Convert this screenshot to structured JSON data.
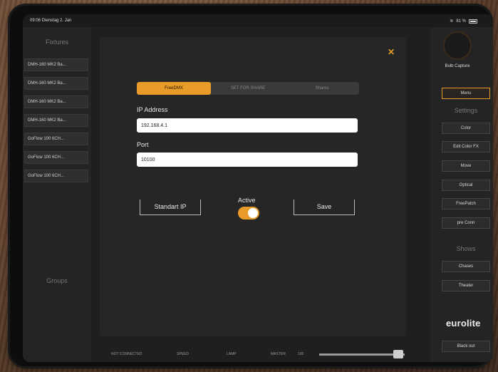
{
  "statusbar": {
    "time_date": "09:06 Dienstag 2. Jan",
    "battery": "81 %"
  },
  "left_sidebar": {
    "fixtures_heading": "Fixtures",
    "fixtures": [
      "DMH-160 MK2 Ba...",
      "DMH-160 MK2 Ba...",
      "DMH-160 MK2 Ba...",
      "DMH-160 MK2 Ba...",
      "GoFlow 100 6CH...",
      "GoFlow 100 6CH...",
      "GoFlow 100 6CH..."
    ],
    "groups_heading": "Groups"
  },
  "modal": {
    "close_label": "✕",
    "segments": [
      "FreeDMX",
      "SET FOR SHARE",
      "Shares"
    ],
    "active_segment": 0,
    "ip_label": "IP Address",
    "ip_value": "192.168.4.1",
    "port_label": "Port",
    "port_value": "10100",
    "standart_ip_label": "Standart IP",
    "active_label": "Active",
    "active_on": true,
    "save_label": "Save"
  },
  "bottom_bar": {
    "status": "NOT CONNECTED",
    "item2": "SPEED",
    "item3": "LAMP",
    "item4": "MASTER",
    "item5": "100",
    "master_level": 0.95
  },
  "right_sidebar": {
    "logo_text": "Bulb Capture",
    "menu_label": "Menu",
    "settings_heading": "Settings",
    "buttons": [
      "Color",
      "Edit Color FX",
      "Move",
      "Optical",
      "FreePatch",
      "pre Conn"
    ],
    "shows_heading": "Shows",
    "show_buttons": [
      "Chases",
      "Theater"
    ],
    "brand": "eurolite",
    "blackout_label": "Black out"
  },
  "colors": {
    "accent": "#e89b28",
    "background": "#1b1b1b",
    "sidebar": "#242424"
  }
}
